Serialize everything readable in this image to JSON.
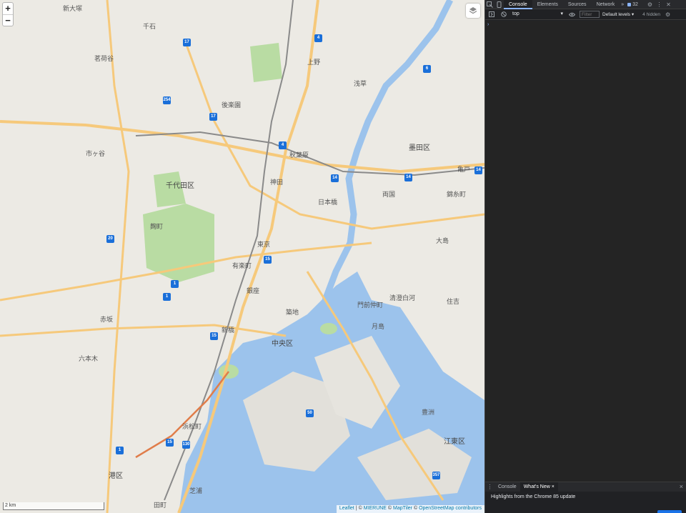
{
  "map": {
    "zoom_in": "+",
    "zoom_out": "−",
    "scale": "2 km",
    "attribution": {
      "leaflet": "Leaflet",
      "sep1": " | © ",
      "mierune": "MIERUNE",
      "sep2": " © ",
      "maptiler": "MapTiler",
      "sep3": " © ",
      "osm": "OpenStreetMap contributors"
    },
    "wards": [
      "千代田区",
      "中央区",
      "墨田区",
      "江東区",
      "港区"
    ],
    "labels": [
      "新大塚",
      "千石",
      "茗荷谷",
      "後楽園",
      "上野",
      "浅草",
      "両国",
      "錦糸町",
      "秋葉原",
      "神田",
      "東京",
      "日本橋",
      "有楽町",
      "銀座",
      "新橋",
      "築地",
      "月島",
      "豊洲",
      "市ヶ谷",
      "麹町",
      "赤坂",
      "六本木",
      "浜松町",
      "芝浦",
      "田町",
      "門前仲町",
      "清澄白河",
      "住吉",
      "大島",
      "亀戸"
    ],
    "route_shields": [
      "17",
      "254",
      "17",
      "4",
      "4",
      "6",
      "14",
      "14",
      "1",
      "1",
      "20",
      "15",
      "1",
      "15",
      "14",
      "50",
      "357",
      "15",
      "130"
    ]
  },
  "devtools": {
    "tabs": [
      "Console",
      "Elements",
      "Sources",
      "Network"
    ],
    "more": "»",
    "badge_count": "32",
    "context": "top",
    "filter_placeholder": "Filter",
    "levels": "Default levels ▾",
    "hidden": "4 hidden",
    "prompt": "›",
    "drawer_tabs": [
      "Console",
      "What's New"
    ],
    "drawer_close": "×",
    "drawer_headline": "Highlights from the Chrome 85 update"
  }
}
